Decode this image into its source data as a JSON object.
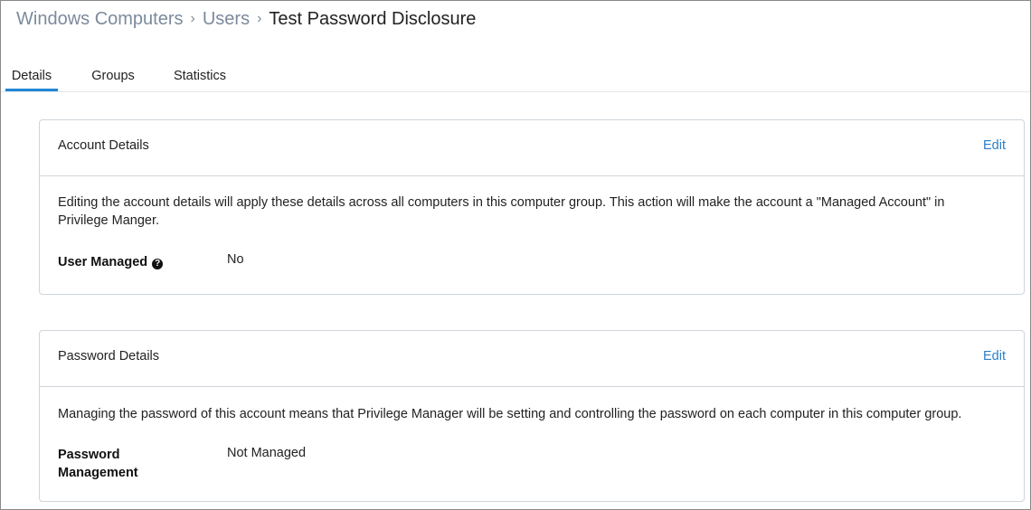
{
  "breadcrumb": {
    "items": [
      "Windows Computers",
      "Users"
    ],
    "separator": "›",
    "current": "Test Password Disclosure"
  },
  "tabs": [
    {
      "label": "Details",
      "active": true
    },
    {
      "label": "Groups",
      "active": false
    },
    {
      "label": "Statistics",
      "active": false
    }
  ],
  "account_card": {
    "title": "Account Details",
    "edit_label": "Edit",
    "description": "Editing the account details will apply these details across all computers in this computer group. This action will make the account a \"Managed Account\" in Privilege Manger.",
    "field_label": "User Managed",
    "field_help_icon": "question-circle-icon",
    "field_value": "No"
  },
  "password_card": {
    "title": "Password Details",
    "edit_label": "Edit",
    "description": "Managing the password of this account means that Privilege Manager will be setting and controlling the password on each computer in this computer group.",
    "field_label": "Password Management",
    "field_value": "Not Managed"
  },
  "colors": {
    "accent": "#1e86d6",
    "link": "#2b7fc8",
    "breadcrumb_muted": "#7b8a9c",
    "border": "#cfd5db"
  }
}
